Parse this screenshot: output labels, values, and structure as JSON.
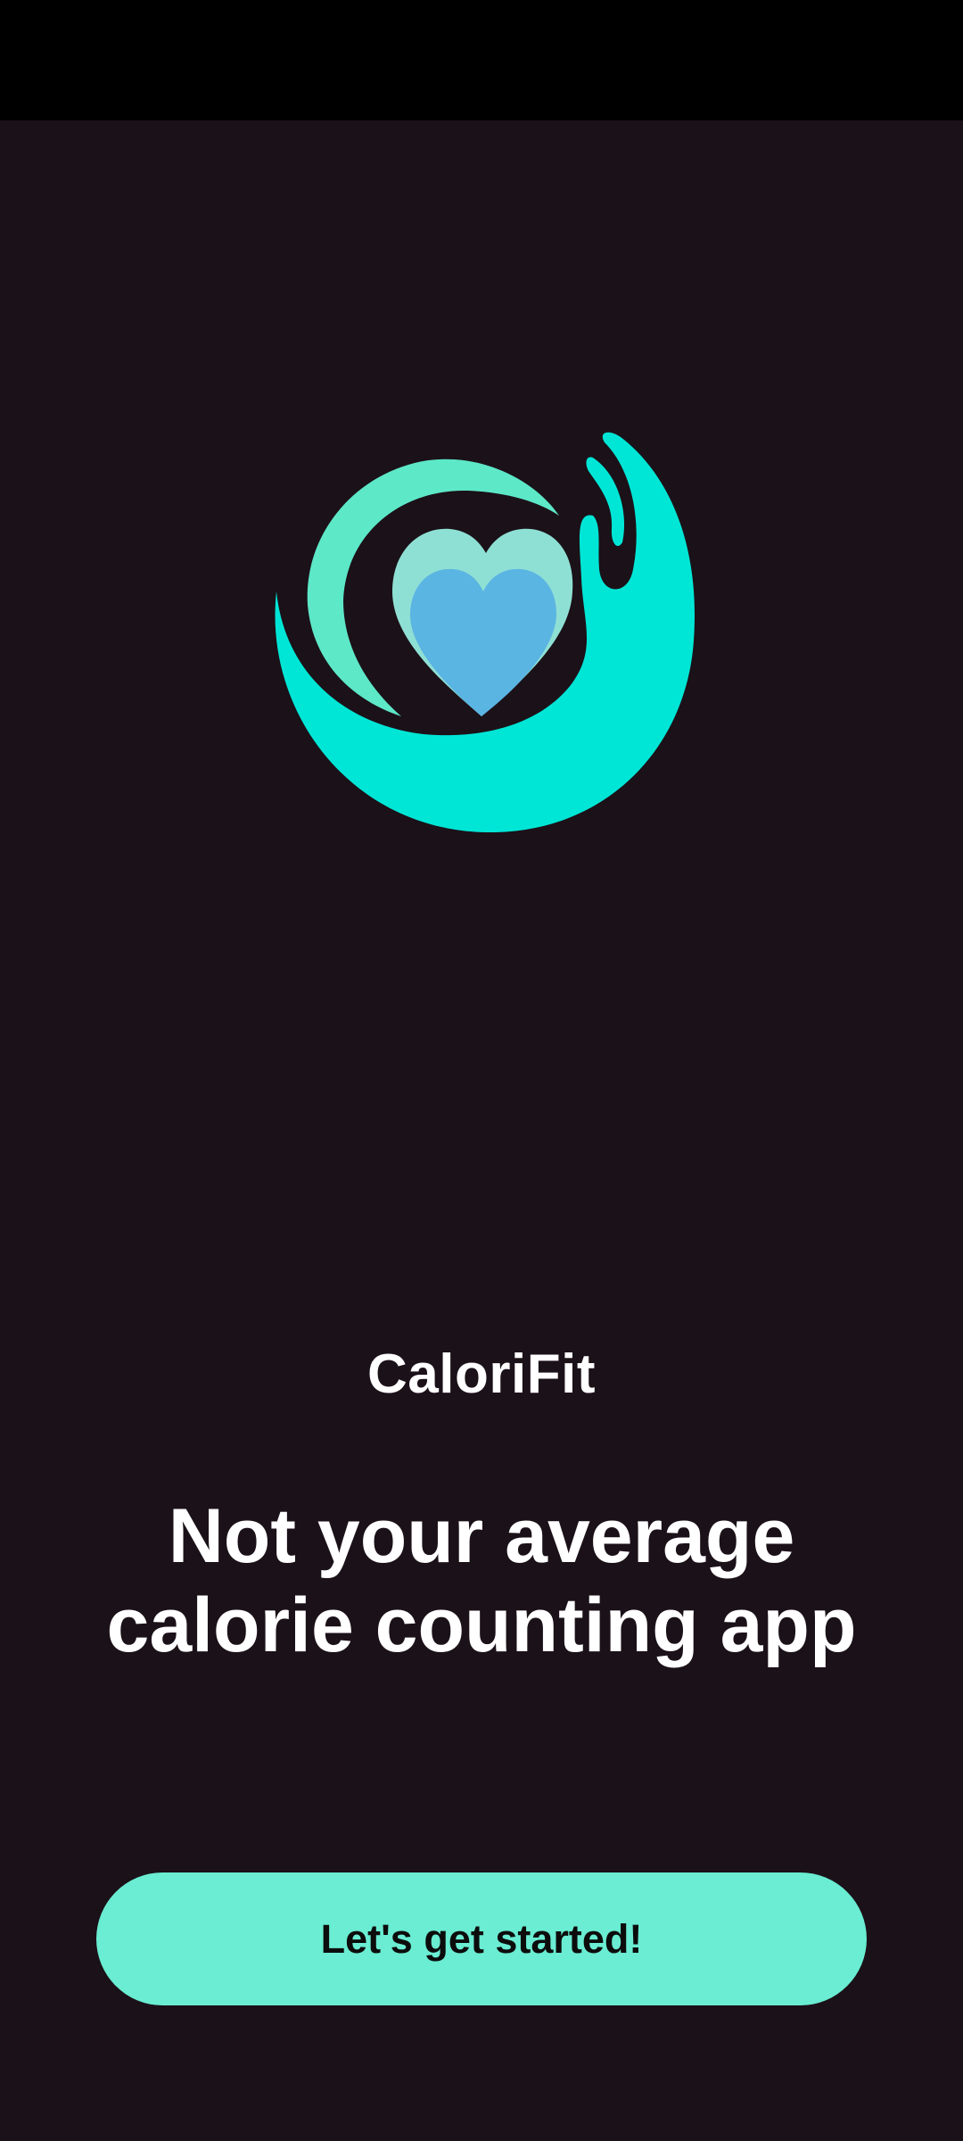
{
  "app": {
    "name": "CaloriFit",
    "tagline": "Not your average calorie counting app"
  },
  "actions": {
    "get_started_label": "Let's get started!"
  },
  "logo": {
    "icon": "hand-holding-heart-icon",
    "colors": {
      "hand": "#00e6d6",
      "ring": "#5de8c8",
      "heart_back": "#8fe0d4",
      "heart_front": "#5bb5e3"
    }
  },
  "theme": {
    "background": "#1b1118",
    "status_bar": "#000000",
    "accent": "#6aedd2",
    "text": "#ffffff"
  }
}
